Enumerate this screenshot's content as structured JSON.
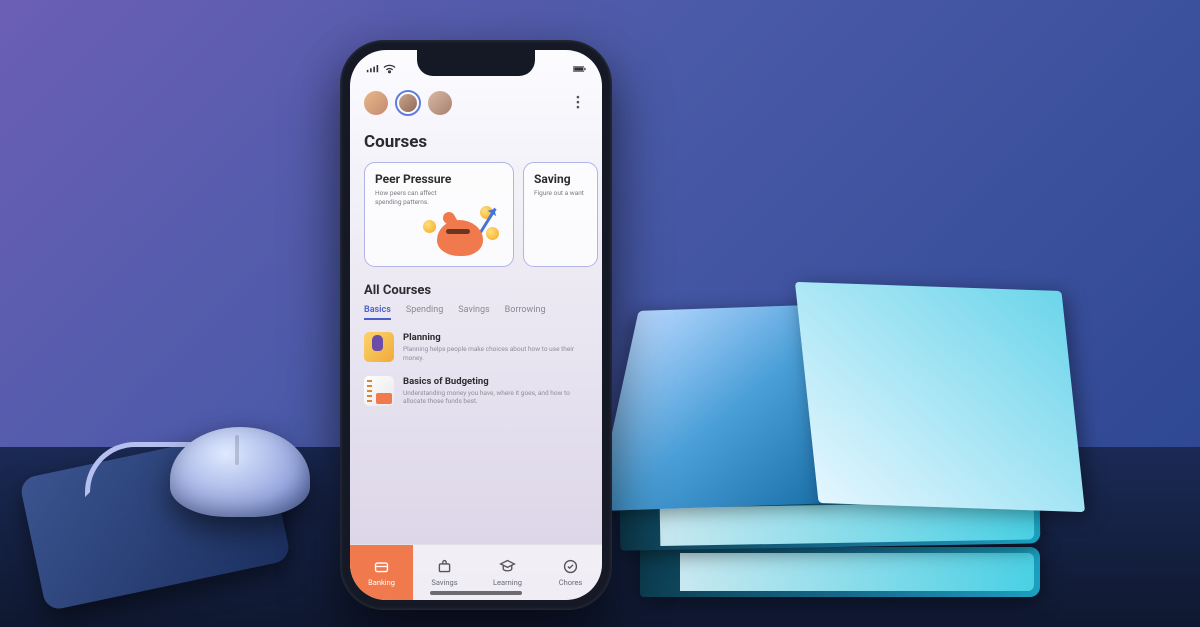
{
  "header": {
    "avatars": [
      "user-1",
      "user-2",
      "user-3"
    ],
    "selected_avatar_index": 1
  },
  "courses": {
    "title": "Courses",
    "featured": [
      {
        "title": "Peer Pressure",
        "desc": "How peers can affect spending patterns."
      },
      {
        "title": "Saving",
        "desc": "Figure out a\nwant"
      }
    ],
    "all_title": "All Courses",
    "tabs": [
      "Basics",
      "Spending",
      "Savings",
      "Borrowing"
    ],
    "active_tab": "Basics",
    "list": [
      {
        "title": "Planning",
        "desc": "Planning helps people make choices about how to use their money."
      },
      {
        "title": "Basics of Budgeting",
        "desc": "Understanding money you have, where it goes, and how to allocate those funds best."
      }
    ]
  },
  "nav": {
    "items": [
      "Banking",
      "Savings",
      "Learning",
      "Chores"
    ],
    "active": "Banking"
  }
}
